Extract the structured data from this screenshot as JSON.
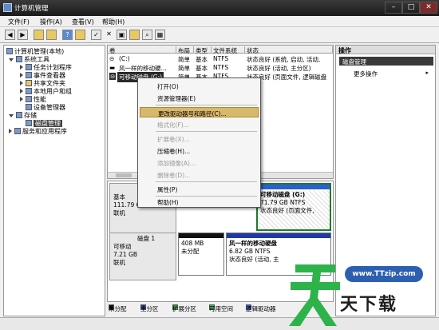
{
  "window": {
    "title": "计算机管理",
    "min": "–",
    "max": "□",
    "close": "✕"
  },
  "menu": [
    "文件(F)",
    "操作(A)",
    "查看(V)",
    "帮助(H)"
  ],
  "tree": {
    "root": "计算机管理(本地)",
    "system_tools": "系统工具",
    "task_scheduler": "任务计划程序",
    "event_viewer": "事件查看器",
    "shared_folders": "共享文件夹",
    "local_users": "本地用户和组",
    "performance": "性能",
    "device_manager": "设备管理器",
    "storage": "存储",
    "disk_management": "磁盘管理",
    "services": "服务和应用程序"
  },
  "list": {
    "headers": [
      "卷",
      "布局",
      "类型",
      "文件系统",
      "状态"
    ],
    "rows": [
      {
        "vol": "(C:)",
        "layout": "简单",
        "type": "基本",
        "fs": "NTFS",
        "status": "状态良好 (系统, 启动, 活动,"
      },
      {
        "vol": "风一样的移动硬…",
        "layout": "简单",
        "type": "基本",
        "fs": "NTFS",
        "status": "状态良好 (活动, 主分区)"
      },
      {
        "vol": "可移动磁盘 (G:)",
        "layout": "简单",
        "type": "基本",
        "fs": "NTFS",
        "status": "状态良好 (页面文件, 逻辑磁盘"
      }
    ]
  },
  "context_menu": {
    "open": "打开(O)",
    "explorer": "资源管理器(E)",
    "change_letter": "更改驱动器号和路径(C)...",
    "format": "格式化(F)...",
    "extend": "扩展卷(X)...",
    "shrink": "压缩卷(H)...",
    "add_mirror": "添加镜像(A)...",
    "delete": "删除卷(D)...",
    "properties": "属性(P)",
    "help": "帮助(H)"
  },
  "disk0": {
    "label": "磁",
    "type": "基本",
    "size": "111.79 GB",
    "state": "联机",
    "removable_part": {
      "title": "可移动磁盘 (G:)",
      "size": "71.79 GB NTFS",
      "status": "状态良好 (页面文件,"
    }
  },
  "disk1": {
    "label": "磁盘 1",
    "type": "可移动",
    "size": "7.21 GB",
    "state": "联机",
    "unalloc": {
      "size": "408 MB",
      "status": "未分配"
    },
    "part": {
      "title": "风一样的移动硬盘",
      "size": "6.82 GB NTFS",
      "status": "状态良好 (活动, 主"
    }
  },
  "legend": [
    "未分配",
    "主分区",
    "扩展分区",
    "可用空间",
    "逻辑驱动器"
  ],
  "actions": {
    "title": "操作",
    "section": "磁盘管理",
    "more": "更多操作"
  },
  "watermark": {
    "url": "www.TTzip.com",
    "name": "天下载"
  },
  "colors": {
    "primary": "#1f3aa8",
    "logical": "#2a5fd6",
    "unallocated": "#111111",
    "extended": "#22a03a",
    "free": "#39b84a",
    "highlight": "#d8b86a",
    "brand_green": "#2db34a"
  }
}
